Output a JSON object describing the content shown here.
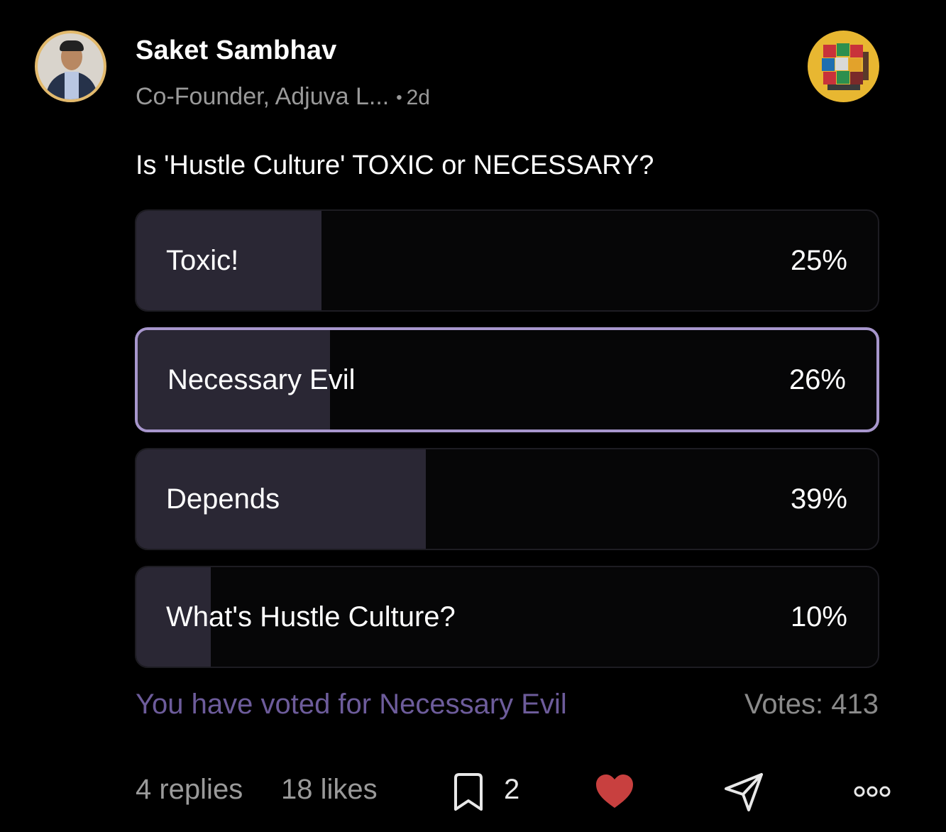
{
  "post": {
    "author_name": "Saket Sambhav",
    "author_subtitle": "Co-Founder, Adjuva L...",
    "separator": "•",
    "age": "2d",
    "question": "Is 'Hustle Culture' TOXIC or NECESSARY?"
  },
  "poll": {
    "options": [
      {
        "label": "Toxic!",
        "percent_text": "25%",
        "percent": 25,
        "selected": false
      },
      {
        "label": "Necessary Evil",
        "percent_text": "26%",
        "percent": 26,
        "selected": true
      },
      {
        "label": "Depends",
        "percent_text": "39%",
        "percent": 39,
        "selected": false
      },
      {
        "label": "What's Hustle Culture?",
        "percent_text": "10%",
        "percent": 10,
        "selected": false
      }
    ],
    "voted_text": "You have voted for Necessary Evil",
    "votes_text": "Votes: 413"
  },
  "footer": {
    "replies": "4 replies",
    "likes": "18 likes",
    "comment_count": "2"
  },
  "icons": {
    "comment": "comment-icon",
    "like": "heart-icon",
    "share": "send-icon",
    "more": "more-icon"
  },
  "colors": {
    "background": "#000000",
    "selected_border": "#a796cc",
    "bar_fill": "#2a2734",
    "voted_text": "#6d5c9b",
    "heart": "#c8403f",
    "avatar_ring": "#e3ba6d",
    "community_bg": "#e8b731"
  }
}
